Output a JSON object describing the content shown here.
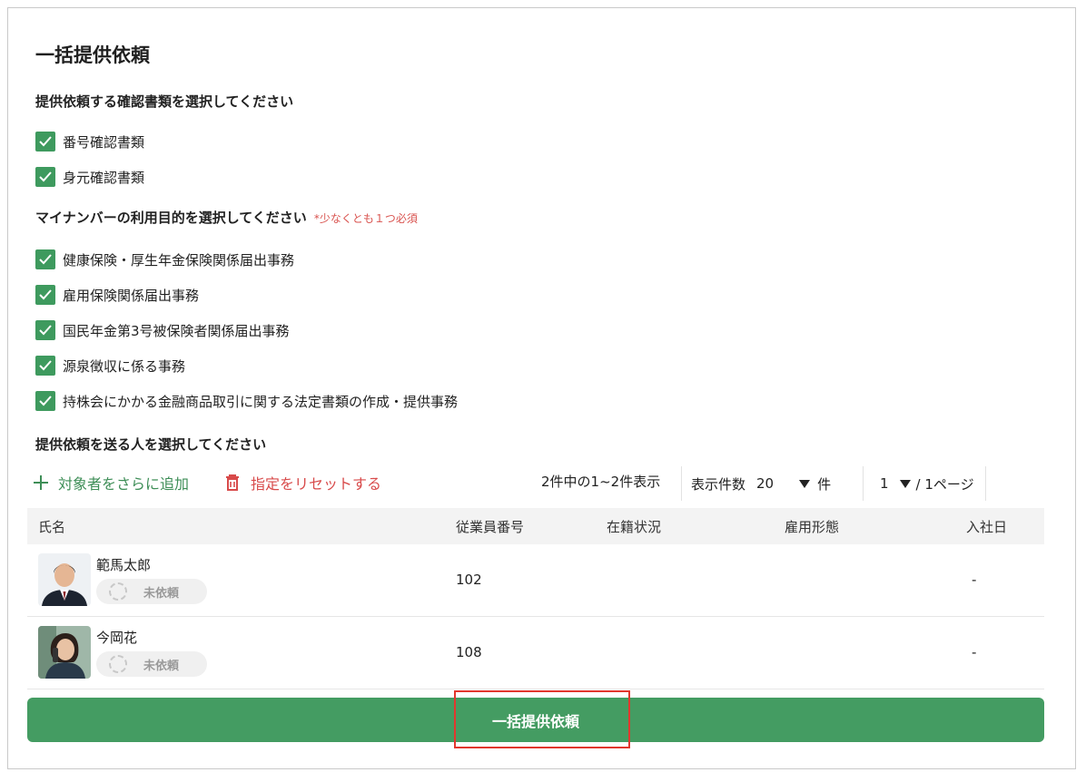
{
  "title": "一括提供依頼",
  "doc_section": {
    "heading": "提供依頼する確認書類を選択してください",
    "items": [
      {
        "label": "番号確認書類",
        "checked": true
      },
      {
        "label": "身元確認書類",
        "checked": true
      }
    ]
  },
  "purpose_section": {
    "heading": "マイナンバーの利用目的を選択してください",
    "required_note": "*少なくとも１つ必須",
    "items": [
      {
        "label": "健康保険・厚生年金保険関係届出事務",
        "checked": true
      },
      {
        "label": "雇用保険関係届出事務",
        "checked": true
      },
      {
        "label": "国民年金第3号被保険者関係届出事務",
        "checked": true
      },
      {
        "label": "源泉徴収に係る事務",
        "checked": true
      },
      {
        "label": "持株会にかかる金融商品取引に関する法定書類の作成・提供事務",
        "checked": true
      }
    ]
  },
  "recipients_section": {
    "heading": "提供依頼を送る人を選択してください"
  },
  "toolbar": {
    "add_label": "対象者をさらに追加",
    "reset_label": "指定をリセットする",
    "count_text": "2件中の1~2件表示",
    "per_page_label": "表示件数",
    "per_page_value": "20",
    "per_page_unit": "件",
    "page_value": "1",
    "page_total": "/ 1ページ"
  },
  "table": {
    "headers": {
      "name": "氏名",
      "employee_no": "従業員番号",
      "status": "在籍状況",
      "employment_type": "雇用形態",
      "join_date": "入社日"
    },
    "rows": [
      {
        "name": "範馬太郎",
        "badge": "未依頼",
        "employee_no": "102",
        "status": "",
        "employment_type": "",
        "join_date": "-"
      },
      {
        "name": "今岡花",
        "badge": "未依頼",
        "employee_no": "108",
        "status": "",
        "employment_type": "",
        "join_date": "-"
      }
    ]
  },
  "submit_label": "一括提供依頼",
  "colors": {
    "accent_green": "#449c62",
    "checkbox_green": "#3e9a5e",
    "danger_red": "#d84a4a",
    "highlight_red": "#e2372e"
  }
}
